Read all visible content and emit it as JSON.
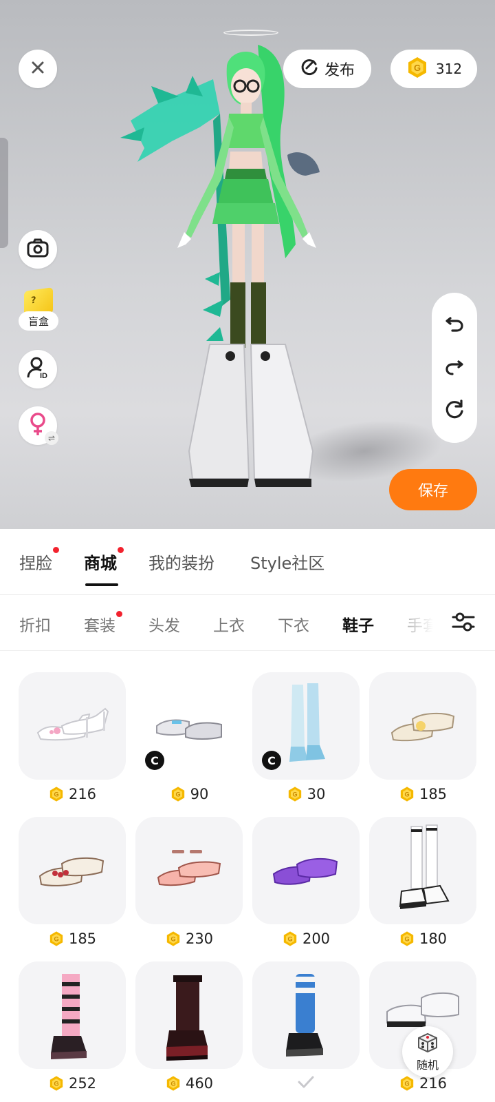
{
  "stage": {
    "publish_label": "发布",
    "coin_balance": "312",
    "blindbox_label": "盲盒",
    "save_label": "保存"
  },
  "main_tabs": [
    {
      "label": "捏脸",
      "active": false,
      "dot": true
    },
    {
      "label": "商城",
      "active": true,
      "dot": true
    },
    {
      "label": "我的装扮",
      "active": false,
      "dot": false
    },
    {
      "label": "Style社区",
      "active": false,
      "dot": false
    }
  ],
  "sub_tabs": [
    {
      "label": "折扣",
      "active": false
    },
    {
      "label": "套装",
      "active": false,
      "dot": true
    },
    {
      "label": "头发",
      "active": false
    },
    {
      "label": "上衣",
      "active": false
    },
    {
      "label": "下衣",
      "active": false
    },
    {
      "label": "鞋子",
      "active": true
    },
    {
      "label": "手套",
      "active": false
    }
  ],
  "items": [
    {
      "price": "216",
      "shoe": "white-heels",
      "creator": false
    },
    {
      "price": "90",
      "shoe": "white-slides",
      "creator": true
    },
    {
      "price": "30",
      "shoe": "blue-boots",
      "creator": true
    },
    {
      "price": "185",
      "shoe": "beige-sandals",
      "creator": false
    },
    {
      "price": "185",
      "shoe": "red-flower-sandals",
      "creator": false
    },
    {
      "price": "230",
      "shoe": "pink-sandals",
      "creator": false
    },
    {
      "price": "200",
      "shoe": "purple-slippers",
      "creator": false
    },
    {
      "price": "180",
      "shoe": "sneakers-socks",
      "creator": false
    },
    {
      "price": "252",
      "shoe": "pink-striped-boots",
      "creator": false
    },
    {
      "price": "460",
      "shoe": "platform-boots",
      "creator": false
    },
    {
      "price": "",
      "shoe": "blue-leg-warmers",
      "creator": false,
      "owned": true
    },
    {
      "price": "216",
      "shoe": "white-platforms",
      "creator": false
    }
  ],
  "random_label": "随机",
  "colors": {
    "accent": "#ff7a10",
    "coin": "#f5b800",
    "red_dot": "#f2222e"
  }
}
